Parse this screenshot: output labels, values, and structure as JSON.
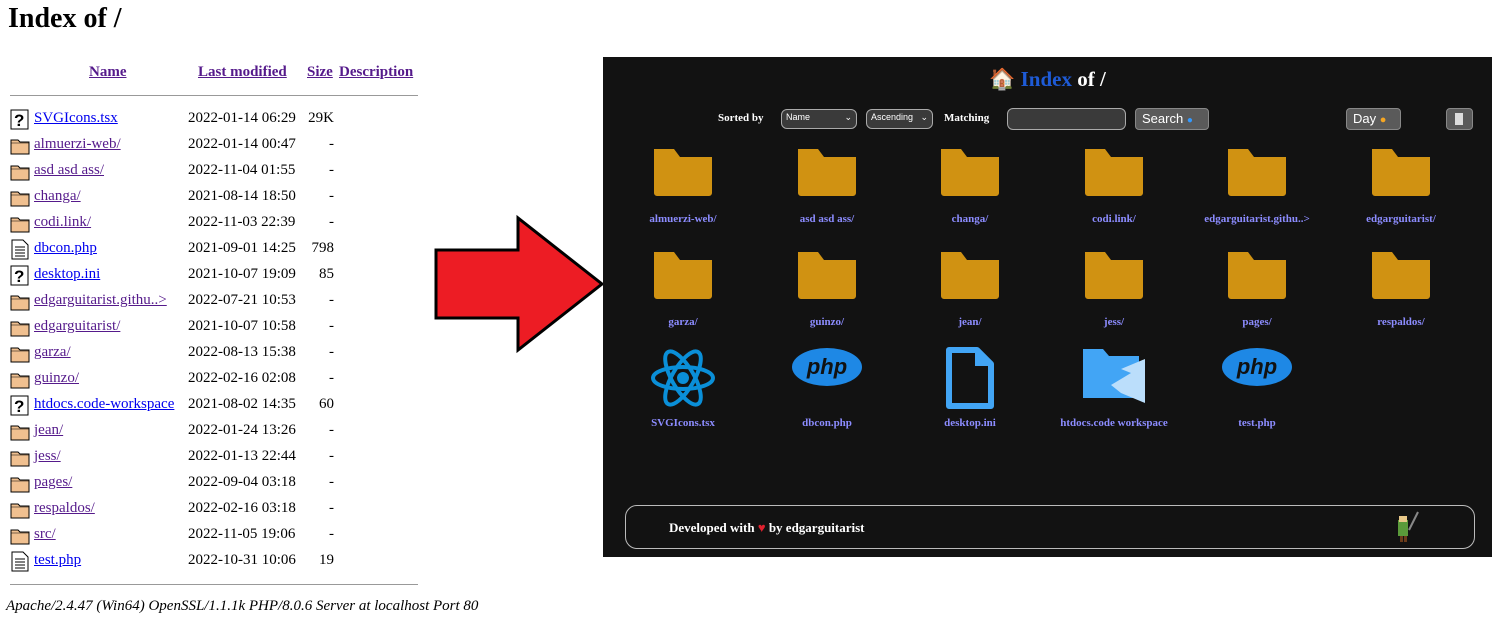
{
  "listing": {
    "title": "Index of /",
    "headers": {
      "name": "Name",
      "modified": "Last modified",
      "size": "Size",
      "description": "Description"
    },
    "rows": [
      {
        "icon": "unknown-file-icon",
        "name": "SVGIcons.tsx",
        "modified": "2022-01-14 06:29",
        "size": "29K",
        "visited": false
      },
      {
        "icon": "folder-icon",
        "name": "almuerzi-web/",
        "modified": "2022-01-14 00:47",
        "size": "-",
        "visited": true
      },
      {
        "icon": "folder-icon",
        "name": "asd asd ass/",
        "modified": "2022-11-04 01:55",
        "size": "-",
        "visited": true
      },
      {
        "icon": "folder-icon",
        "name": "changa/",
        "modified": "2021-08-14 18:50",
        "size": "-",
        "visited": true
      },
      {
        "icon": "folder-icon",
        "name": "codi.link/",
        "modified": "2022-11-03 22:39",
        "size": "-",
        "visited": true
      },
      {
        "icon": "text-file-icon",
        "name": "dbcon.php",
        "modified": "2021-09-01 14:25",
        "size": "798",
        "visited": false
      },
      {
        "icon": "unknown-file-icon",
        "name": "desktop.ini",
        "modified": "2021-10-07 19:09",
        "size": "85",
        "visited": false
      },
      {
        "icon": "folder-icon",
        "name": "edgarguitarist.githu..>",
        "modified": "2022-07-21 10:53",
        "size": "-",
        "visited": true
      },
      {
        "icon": "folder-icon",
        "name": "edgarguitarist/",
        "modified": "2021-10-07 10:58",
        "size": "-",
        "visited": true
      },
      {
        "icon": "folder-icon",
        "name": "garza/",
        "modified": "2022-08-13 15:38",
        "size": "-",
        "visited": true
      },
      {
        "icon": "folder-icon",
        "name": "guinzo/",
        "modified": "2022-02-16 02:08",
        "size": "-",
        "visited": true
      },
      {
        "icon": "unknown-file-icon",
        "name": "htdocs.code-workspace",
        "modified": "2021-08-02 14:35",
        "size": "60",
        "visited": false
      },
      {
        "icon": "folder-icon",
        "name": "jean/",
        "modified": "2022-01-24 13:26",
        "size": "-",
        "visited": true
      },
      {
        "icon": "folder-icon",
        "name": "jess/",
        "modified": "2022-01-13 22:44",
        "size": "-",
        "visited": true
      },
      {
        "icon": "folder-icon",
        "name": "pages/",
        "modified": "2022-09-04 03:18",
        "size": "-",
        "visited": true
      },
      {
        "icon": "folder-icon",
        "name": "respaldos/",
        "modified": "2022-02-16 03:18",
        "size": "-",
        "visited": true
      },
      {
        "icon": "folder-icon",
        "name": "src/",
        "modified": "2022-11-05 19:06",
        "size": "-",
        "visited": true
      },
      {
        "icon": "text-file-icon",
        "name": "test.php",
        "modified": "2022-10-31 10:06",
        "size": "19",
        "visited": false
      }
    ],
    "address": "Apache/2.4.47 (Win64) OpenSSL/1.1.1k PHP/8.0.6 Server at localhost Port 80"
  },
  "arrow_color": "#ed1c24",
  "styled": {
    "title_icon": "house-icon",
    "title_word": "Index",
    "title_rest": " of /",
    "sorted_by": "Sorted by",
    "sort_value": "Name",
    "order_value": "Ascending",
    "matching": "Matching",
    "search_value": "",
    "search_button": "Search",
    "theme_button": "Day",
    "accent": "#1e5bd6",
    "folder_color": "#d09212",
    "items": [
      {
        "icon": "folder-icon",
        "label": "almuerzi-web/"
      },
      {
        "icon": "folder-icon",
        "label": "asd asd ass/"
      },
      {
        "icon": "folder-icon",
        "label": "changa/"
      },
      {
        "icon": "folder-icon",
        "label": "codi.link/"
      },
      {
        "icon": "folder-icon",
        "label": "edgarguitarist.githu..>"
      },
      {
        "icon": "folder-icon",
        "label": "edgarguitarist/"
      },
      {
        "icon": "folder-icon",
        "label": "garza/"
      },
      {
        "icon": "folder-icon",
        "label": "guinzo/"
      },
      {
        "icon": "folder-icon",
        "label": "jean/"
      },
      {
        "icon": "folder-icon",
        "label": "jess/"
      },
      {
        "icon": "folder-icon",
        "label": "pages/"
      },
      {
        "icon": "folder-icon",
        "label": "respaldos/"
      },
      {
        "icon": "react-icon",
        "label": "SVGIcons.tsx"
      },
      {
        "icon": "php-icon",
        "label": "dbcon.php"
      },
      {
        "icon": "file-icon",
        "label": "desktop.ini"
      },
      {
        "icon": "vscode-folder-icon",
        "label": "htdocs.code workspace"
      },
      {
        "icon": "php-icon",
        "label": "test.php"
      }
    ],
    "footer": {
      "pre": "Developed with",
      "post": "by edgarguitarist"
    }
  }
}
